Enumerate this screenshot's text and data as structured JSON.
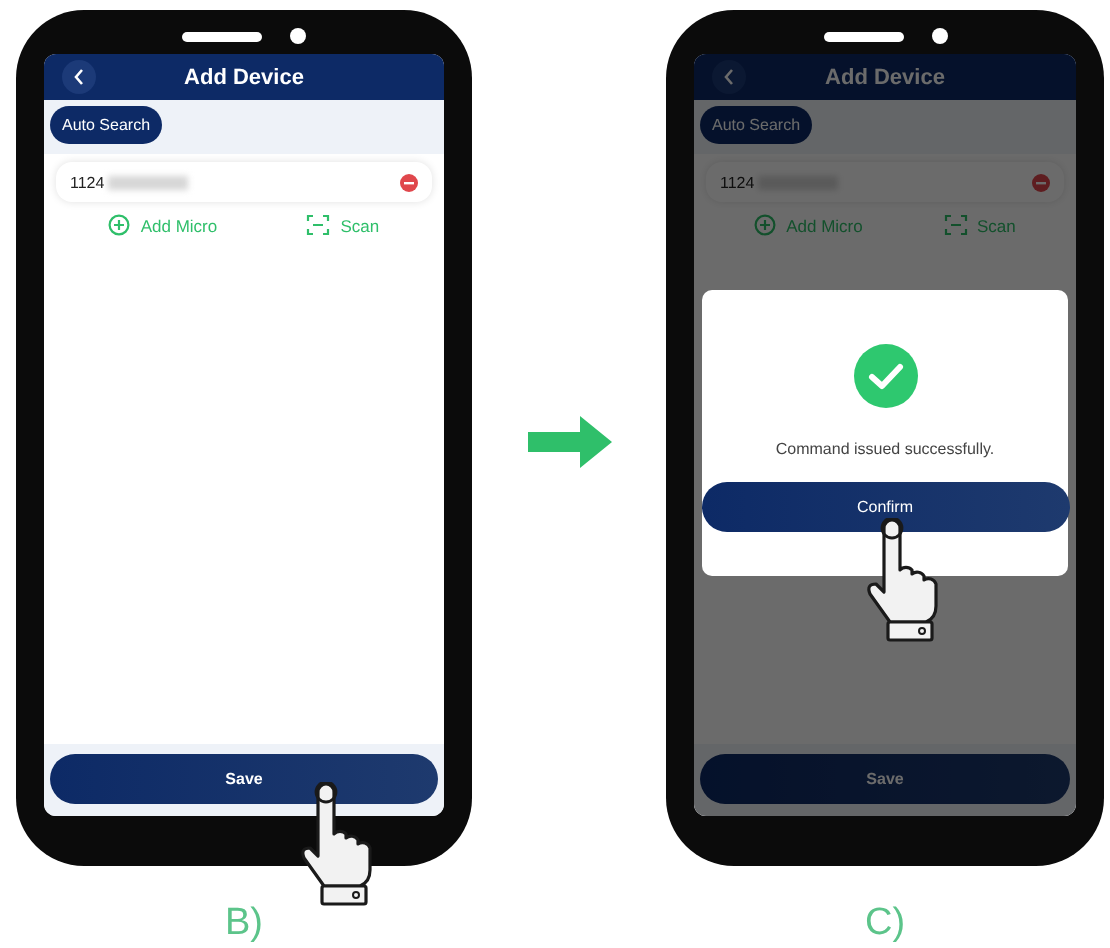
{
  "phones": [
    {
      "caption": "B)",
      "dimmed": false,
      "screen": {
        "title": "Add Device",
        "auto_search": "Auto Search",
        "device_id": "1124",
        "add_micro": "Add Micro",
        "scan": "Scan",
        "save": {
          "label": "Save",
          "tapped": true
        }
      }
    },
    {
      "caption": "C)",
      "dimmed": true,
      "screen": {
        "title": "Add Device",
        "auto_search": "Auto Search",
        "device_id": "1124",
        "add_micro": "Add Micro",
        "scan": "Scan",
        "save": {
          "label": "Save",
          "tapped": false
        }
      },
      "dialog": {
        "message": "Command issued successfully.",
        "confirm": {
          "label": "Confirm",
          "tapped": true
        }
      }
    }
  ]
}
